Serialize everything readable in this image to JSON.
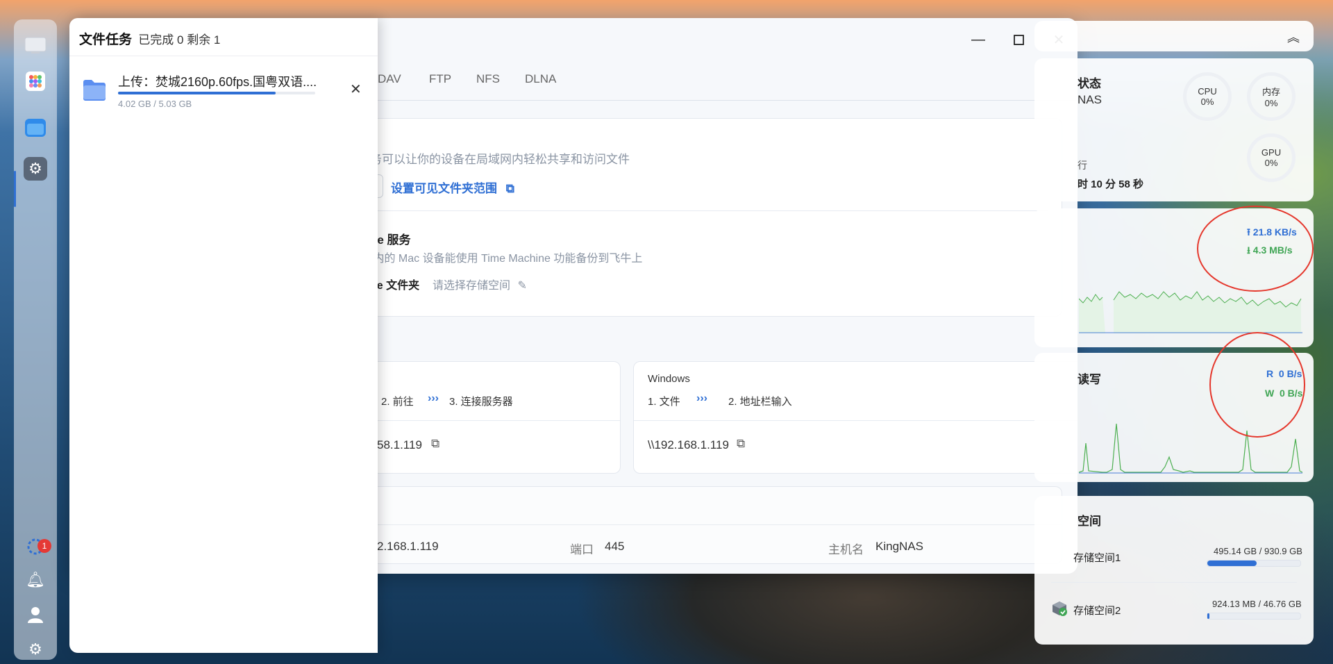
{
  "task_panel": {
    "title": "文件任务",
    "summary": "已完成 0 剩余 1",
    "item": {
      "name": "上传：焚城2160p.60fps.国粤双语....",
      "size": "4.02 GB / 5.03 GB",
      "progress": 0.8
    }
  },
  "window": {
    "tabs": [
      "DAV",
      "FTP",
      "NFS",
      "DLNA"
    ],
    "smb": {
      "description": "务可以让你的设备在局域网内轻松共享和访问文件",
      "folder_link": "设置可见文件夹范围",
      "enabled": true
    },
    "timemachine": {
      "title": "ne 服务",
      "description": "]内的 Mac 设备能使用 Time Machine 功能备份到飞牛上",
      "folder_label": "ne 文件夹",
      "folder_value": "请选择存储空间",
      "enabled": false
    },
    "mac_card": {
      "step2": "2. 前往",
      "step3": "3. 连接服务器",
      "address": "58.1.119"
    },
    "windows_card": {
      "title": "Windows",
      "step1": "1. 文件",
      "step2": "2. 地址栏输入",
      "address": "\\\\192.168.1.119"
    },
    "info": {
      "ip": "2.168.1.119",
      "port_label": "端口",
      "port_value": "445",
      "host_label": "主机名",
      "host_value": "KingNAS"
    }
  },
  "widgets": {
    "status": {
      "title": "状态",
      "subtitle": "NAS",
      "running_label": "行",
      "uptime": "时 10 分 58 秒",
      "cpu_label": "CPU",
      "cpu_value": "0%",
      "mem_label": "内存",
      "mem_value": "0%",
      "gpu_label": "GPU",
      "gpu_value": "0%"
    },
    "network": {
      "upload": "21.8 KB/s",
      "download": "4.3 MB/s"
    },
    "disk": {
      "title": "读写",
      "read": "R  0 B/s",
      "write": "W  0 B/s"
    },
    "storage": {
      "title": "空间",
      "items": [
        {
          "name": "存储空间1",
          "usage": "495.14 GB / 930.9 GB",
          "fraction": 0.532
        },
        {
          "name": "存储空间2",
          "usage": "924.13 MB / 46.76 GB",
          "fraction": 0.02
        }
      ]
    }
  },
  "dock": {
    "badge_count": "1"
  }
}
